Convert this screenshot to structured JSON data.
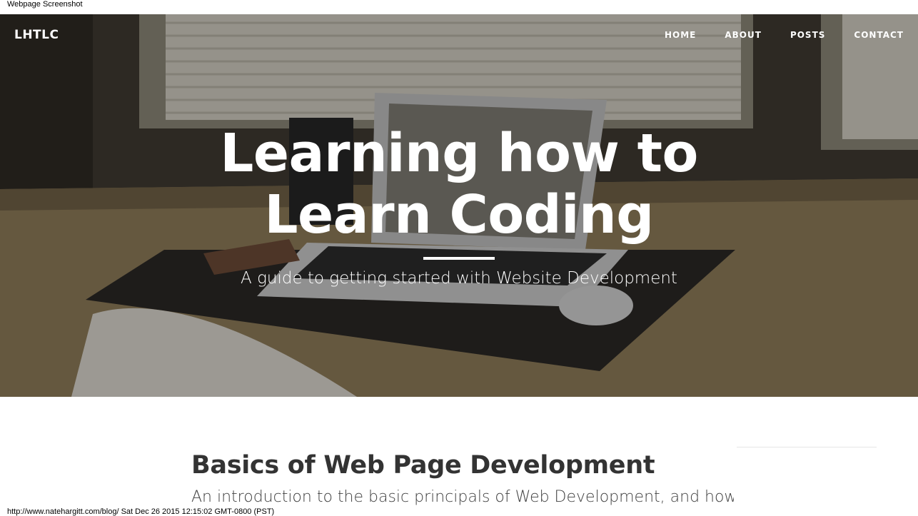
{
  "capture": {
    "top_caption": "Webpage Screenshot",
    "footer_caption": "http://www.natehargitt.com/blog/ Sat Dec 26 2015 12:15:02 GMT-0800 (PST)"
  },
  "nav": {
    "brand": "LHTLC",
    "items": [
      "HOME",
      "ABOUT",
      "POSTS",
      "CONTACT"
    ]
  },
  "hero": {
    "title_line1": "Learning how to",
    "title_line2": "Learn Coding",
    "subtitle": "A guide to getting started with Website Development"
  },
  "post": {
    "title": "Basics of Web Page Development",
    "subtitle": "An introduction to the basic principals of Web Development, and how"
  },
  "colors": {
    "hero_text": "#ffffff",
    "post_title": "#333333",
    "post_subtitle": "#404040"
  }
}
